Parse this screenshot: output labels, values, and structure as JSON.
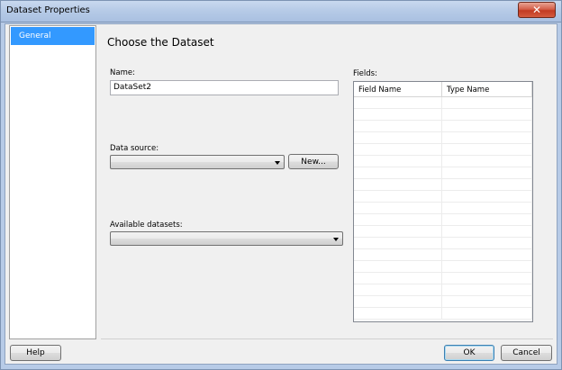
{
  "window": {
    "title": "Dataset Properties",
    "close_glyph": "✕"
  },
  "nav": {
    "items": [
      {
        "label": "General",
        "selected": true
      }
    ]
  },
  "main": {
    "heading": "Choose the Dataset",
    "name_label": "Name:",
    "name_value": "DataSet2",
    "data_source_label": "Data source:",
    "data_source_value": "",
    "new_button": "New...",
    "available_datasets_label": "Available datasets:",
    "available_datasets_value": ""
  },
  "fields": {
    "label": "Fields:",
    "columns": [
      "Field Name",
      "Type Name"
    ],
    "rows": []
  },
  "footer": {
    "help": "Help",
    "ok": "OK",
    "cancel": "Cancel"
  },
  "colors": {
    "selection": "#3399ff",
    "window_frame": "#b7cbe7",
    "close_button": "#c23a22"
  }
}
